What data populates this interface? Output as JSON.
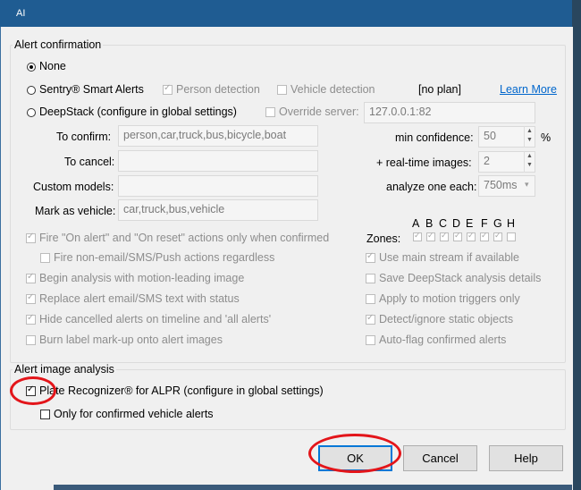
{
  "window": {
    "title": "AI"
  },
  "alert_confirmation": {
    "legend": "Alert confirmation",
    "options": {
      "none": "None",
      "sentry": "Sentry® Smart Alerts",
      "deepstack": "DeepStack (configure in global settings)"
    },
    "person_detection": "Person detection",
    "vehicle_detection": "Vehicle detection",
    "plan_status": "[no plan]",
    "learn_more": "Learn More",
    "override_server": "Override server:",
    "server_value": "127.0.0.1:82",
    "to_confirm_label": "To confirm:",
    "to_confirm_value": "person,car,truck,bus,bicycle,boat",
    "to_cancel_label": "To cancel:",
    "to_cancel_value": "",
    "custom_models_label": "Custom models:",
    "custom_models_value": "",
    "mark_vehicle_label": "Mark as vehicle:",
    "mark_vehicle_value": "car,truck,bus,vehicle",
    "min_confidence_label": "min confidence:",
    "min_confidence_value": "50",
    "min_confidence_unit": "%",
    "realtime_label": "+ real-time images:",
    "realtime_value": "2",
    "analyze_label": "analyze one each:",
    "analyze_value": "750ms",
    "zones_label": "Zones:",
    "zone_letters": [
      "A",
      "B",
      "C",
      "D",
      "E",
      "F",
      "G",
      "H"
    ],
    "left_checks": [
      "Fire \"On alert\" and \"On reset\" actions only when confirmed",
      "Fire non-email/SMS/Push actions regardless",
      "Begin analysis with motion-leading image",
      "Replace alert email/SMS text with status",
      "Hide cancelled alerts on timeline and  'all alerts'",
      "Burn label mark-up onto alert images"
    ],
    "right_checks": [
      "Use main stream if available",
      "Save DeepStack analysis details",
      "Apply to motion triggers only",
      "Detect/ignore static objects",
      "Auto-flag confirmed alerts"
    ]
  },
  "image_analysis": {
    "legend": "Alert image analysis",
    "plate_recognizer": "Plate Recognizer® for ALPR (configure in global settings)",
    "only_vehicle": "Only for confirmed vehicle alerts"
  },
  "buttons": {
    "ok": "OK",
    "cancel": "Cancel",
    "help": "Help"
  },
  "colors": {
    "title_bar": "#1f5c92",
    "default_button_border": "#0078d7",
    "annotation_circle": "#e3151a",
    "link": "#0066cc"
  }
}
